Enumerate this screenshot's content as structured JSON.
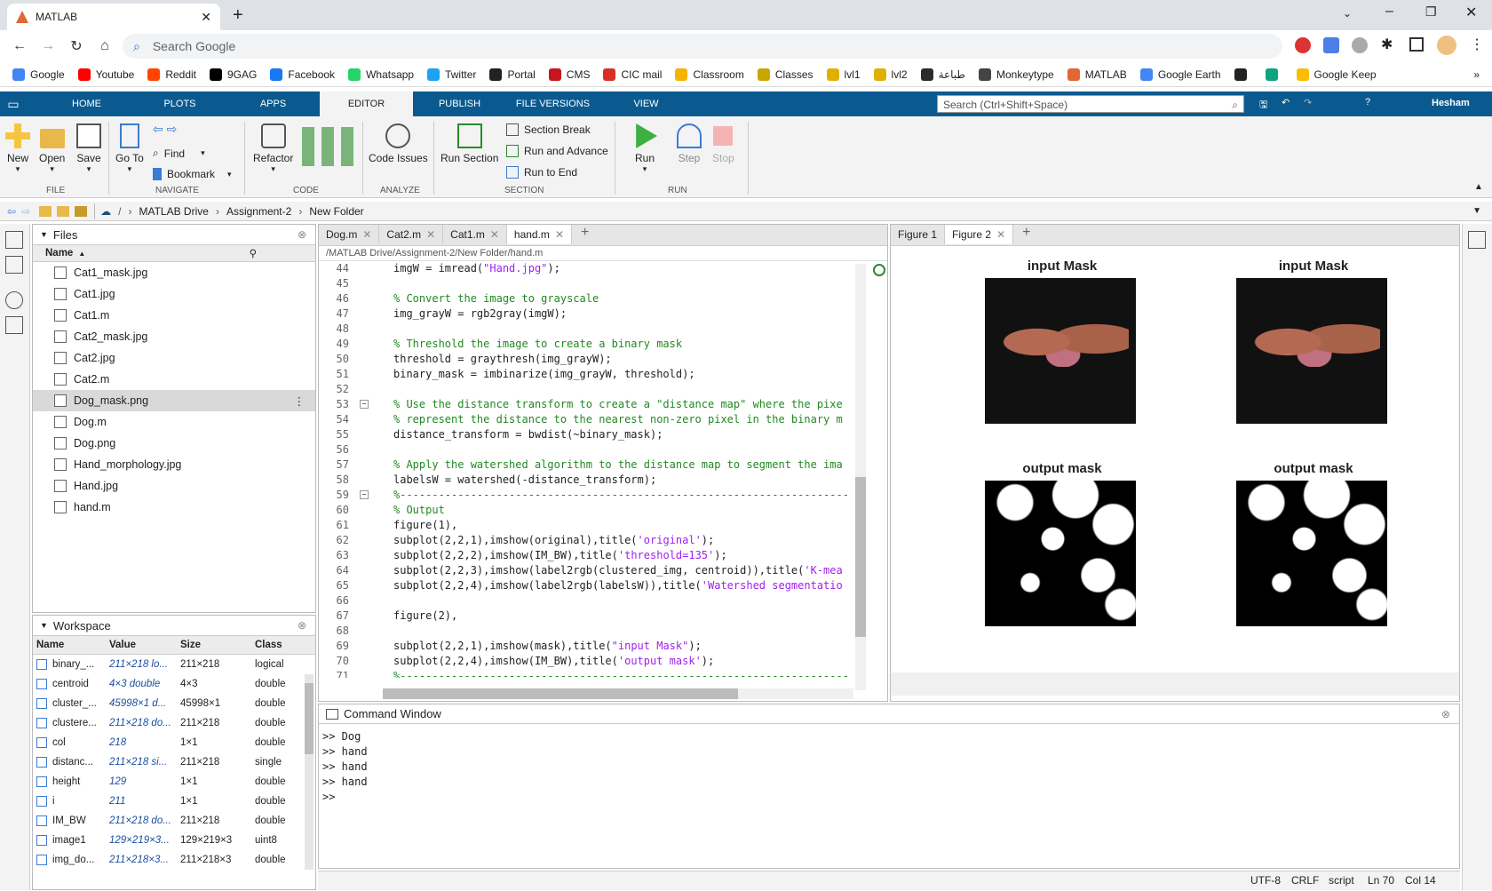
{
  "browser": {
    "tab_title": "MATLAB",
    "omnibox_placeholder": "Search Google",
    "bookmarks": [
      {
        "label": "Google",
        "color": "#4285f4"
      },
      {
        "label": "Youtube",
        "color": "#ff0000"
      },
      {
        "label": "Reddit",
        "color": "#ff4500"
      },
      {
        "label": "9GAG",
        "color": "#000000"
      },
      {
        "label": "Facebook",
        "color": "#1877f2"
      },
      {
        "label": "Whatsapp",
        "color": "#25d366"
      },
      {
        "label": "Twitter",
        "color": "#1da1f2"
      },
      {
        "label": "Portal",
        "color": "#222222"
      },
      {
        "label": "CMS",
        "color": "#c4161c"
      },
      {
        "label": "CIC mail",
        "color": "#d93025"
      },
      {
        "label": "Classroom",
        "color": "#f4b400"
      },
      {
        "label": "Classes",
        "color": "#c8a600"
      },
      {
        "label": "lvl1",
        "color": "#e0b000"
      },
      {
        "label": "lvl2",
        "color": "#e0b000"
      },
      {
        "label": "طباعة",
        "color": "#2a2a2a"
      },
      {
        "label": "Monkeytype",
        "color": "#444444"
      },
      {
        "label": "MATLAB",
        "color": "#e16737"
      },
      {
        "label": "Google Earth",
        "color": "#4285f4"
      },
      {
        "label": "",
        "color": "#222222"
      },
      {
        "label": "",
        "color": "#10a37f"
      },
      {
        "label": "Google Keep",
        "color": "#fbbc04"
      }
    ]
  },
  "matlab": {
    "tabs": [
      "HOME",
      "PLOTS",
      "APPS",
      "EDITOR",
      "PUBLISH",
      "FILE VERSIONS",
      "VIEW"
    ],
    "active_tab": "EDITOR",
    "search_placeholder": "Search (Ctrl+Shift+Space)",
    "user": "Hesham",
    "ribbon": {
      "new": "New",
      "open": "Open",
      "save": "Save",
      "goto": "Go To",
      "find": "Find",
      "bookmark": "Bookmark",
      "refactor": "Refactor",
      "code_issues": "Code Issues",
      "run_section": "Run Section",
      "section_break": "Section Break",
      "run_and_advance": "Run and Advance",
      "run_to_end": "Run to End",
      "run": "Run",
      "step": "Step",
      "stop": "Stop",
      "groups": {
        "file": "FILE",
        "navigate": "NAVIGATE",
        "code": "CODE",
        "analyze": "ANALYZE",
        "section": "SECTION",
        "run": "RUN"
      }
    },
    "path": [
      "MATLAB Drive",
      "Assignment-2",
      "New Folder"
    ],
    "files_panel": {
      "title": "Files",
      "col_name": "Name",
      "items": [
        "Cat1_mask.jpg",
        "Cat1.jpg",
        "Cat1.m",
        "Cat2_mask.jpg",
        "Cat2.jpg",
        "Cat2.m",
        "Dog_mask.png",
        "Dog.m",
        "Dog.png",
        "Hand_morphology.jpg",
        "Hand.jpg",
        "hand.m"
      ],
      "selected": "Dog_mask.png"
    },
    "workspace": {
      "title": "Workspace",
      "cols": [
        "Name",
        "Value",
        "Size",
        "Class"
      ],
      "rows": [
        {
          "name": "binary_...",
          "value": "211×218 lo...",
          "size": "211×218",
          "class": "logical"
        },
        {
          "name": "centroid",
          "value": "4×3 double",
          "size": "4×3",
          "class": "double"
        },
        {
          "name": "cluster_...",
          "value": "45998×1 d...",
          "size": "45998×1",
          "class": "double"
        },
        {
          "name": "clustere...",
          "value": "211×218 do...",
          "size": "211×218",
          "class": "double"
        },
        {
          "name": "col",
          "value": "218",
          "size": "1×1",
          "class": "double"
        },
        {
          "name": "distanc...",
          "value": "211×218 si...",
          "size": "211×218",
          "class": "single"
        },
        {
          "name": "height",
          "value": "129",
          "size": "1×1",
          "class": "double"
        },
        {
          "name": "i",
          "value": "211",
          "size": "1×1",
          "class": "double"
        },
        {
          "name": "IM_BW",
          "value": "211×218 do...",
          "size": "211×218",
          "class": "double"
        },
        {
          "name": "image1",
          "value": "129×219×3...",
          "size": "129×219×3",
          "class": "uint8"
        },
        {
          "name": "img_do...",
          "value": "211×218×3...",
          "size": "211×218×3",
          "class": "double"
        }
      ]
    },
    "editor": {
      "tabs": [
        "Dog.m",
        "Cat2.m",
        "Cat1.m",
        "hand.m"
      ],
      "active": "hand.m",
      "filepath": "/MATLAB Drive/Assignment-2/New Folder/hand.m",
      "lines": [
        {
          "n": "44",
          "t": "imgW = imread(\"Hand.jpg\");",
          "k": "s"
        },
        {
          "n": "45",
          "t": "",
          "k": ""
        },
        {
          "n": "46",
          "t": "% Convert the image to grayscale",
          "k": "c"
        },
        {
          "n": "47",
          "t": "img_grayW = rgb2gray(imgW);",
          "k": ""
        },
        {
          "n": "48",
          "t": "",
          "k": ""
        },
        {
          "n": "49",
          "t": "% Threshold the image to create a binary mask",
          "k": "c"
        },
        {
          "n": "50",
          "t": "threshold = graythresh(img_grayW);",
          "k": ""
        },
        {
          "n": "51",
          "t": "binary_mask = imbinarize(img_grayW, threshold);",
          "k": ""
        },
        {
          "n": "52",
          "t": "",
          "k": ""
        },
        {
          "n": "53",
          "t": "% Use the distance transform to create a \"distance map\" where the pixe",
          "k": "c"
        },
        {
          "n": "54",
          "t": "% represent the distance to the nearest non-zero pixel in the binary m",
          "k": "c"
        },
        {
          "n": "55",
          "t": "distance_transform = bwdist(~binary_mask);",
          "k": ""
        },
        {
          "n": "56",
          "t": "",
          "k": ""
        },
        {
          "n": "57",
          "t": "% Apply the watershed algorithm to the distance map to segment the ima",
          "k": "c"
        },
        {
          "n": "58",
          "t": "labelsW = watershed(-distance_transform);",
          "k": ""
        },
        {
          "n": "59",
          "t": "%----------------------------------------------------------------------",
          "k": "c"
        },
        {
          "n": "60",
          "t": "% Output",
          "k": "c"
        },
        {
          "n": "61",
          "t": "figure(1),",
          "k": ""
        },
        {
          "n": "62",
          "t": "subplot(2,2,1),imshow(original),title('original');",
          "k": ""
        },
        {
          "n": "63",
          "t": "subplot(2,2,2),imshow(IM_BW),title('threshold=135');",
          "k": ""
        },
        {
          "n": "64",
          "t": "subplot(2,2,3),imshow(label2rgb(clustered_img, centroid)),title('K-mea",
          "k": ""
        },
        {
          "n": "65",
          "t": "subplot(2,2,4),imshow(label2rgb(labelsW)),title('Watershed segmentatio",
          "k": ""
        },
        {
          "n": "66",
          "t": "",
          "k": ""
        },
        {
          "n": "67",
          "t": "figure(2),",
          "k": ""
        },
        {
          "n": "68",
          "t": "",
          "k": ""
        },
        {
          "n": "69",
          "t": "subplot(2,2,1),imshow(mask),title(\"input Mask\");",
          "k": ""
        },
        {
          "n": "70",
          "t": "subplot(2,2,4),imshow(IM_BW),title('output mask');",
          "k": ""
        },
        {
          "n": "71",
          "t": "%----------------------------------------------------------------------",
          "k": "c"
        }
      ]
    },
    "figures": {
      "tabs": [
        "Figure 1",
        "Figure 2"
      ],
      "active": "Figure 2",
      "titles": [
        "input Mask",
        "input Mask",
        "output mask",
        "output mask"
      ]
    },
    "command_window": {
      "title": "Command Window",
      "lines": [
        ">> Dog",
        ">> hand",
        ">> hand",
        ">> hand",
        ">>"
      ]
    },
    "status": {
      "encoding": "UTF-8",
      "eol": "CRLF",
      "type": "script",
      "ln": "Ln 70",
      "col": "Col 14"
    }
  }
}
